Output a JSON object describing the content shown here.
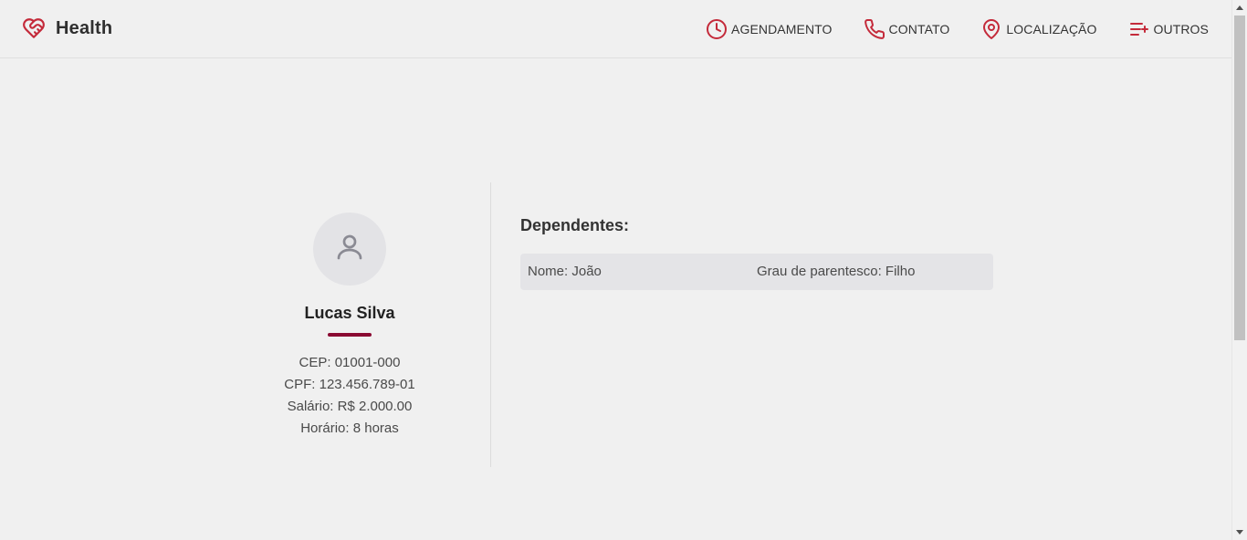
{
  "header": {
    "brand": "Health",
    "nav": [
      {
        "label": "AGENDAMENTO",
        "icon": "clock-icon"
      },
      {
        "label": "CONTATO",
        "icon": "phone-icon"
      },
      {
        "label": "LOCALIZAÇÃO",
        "icon": "map-pin-icon"
      },
      {
        "label": "OUTROS",
        "icon": "list-plus-icon"
      }
    ]
  },
  "profile": {
    "avatar_icon": "user-icon",
    "name": "Lucas Silva",
    "info": [
      "CEP: 01001-000",
      "CPF: 123.456.789-01",
      "Salário: R$ 2.000.00",
      "Horário: 8 horas"
    ]
  },
  "dependents": {
    "title": "Dependentes:",
    "items": [
      {
        "name": "Nome: João",
        "relation": "Grau de parentesco: Filho"
      }
    ]
  },
  "colors": {
    "accent": "#c42a3a",
    "underline": "#8a0a32",
    "background": "#f0f0f0"
  }
}
